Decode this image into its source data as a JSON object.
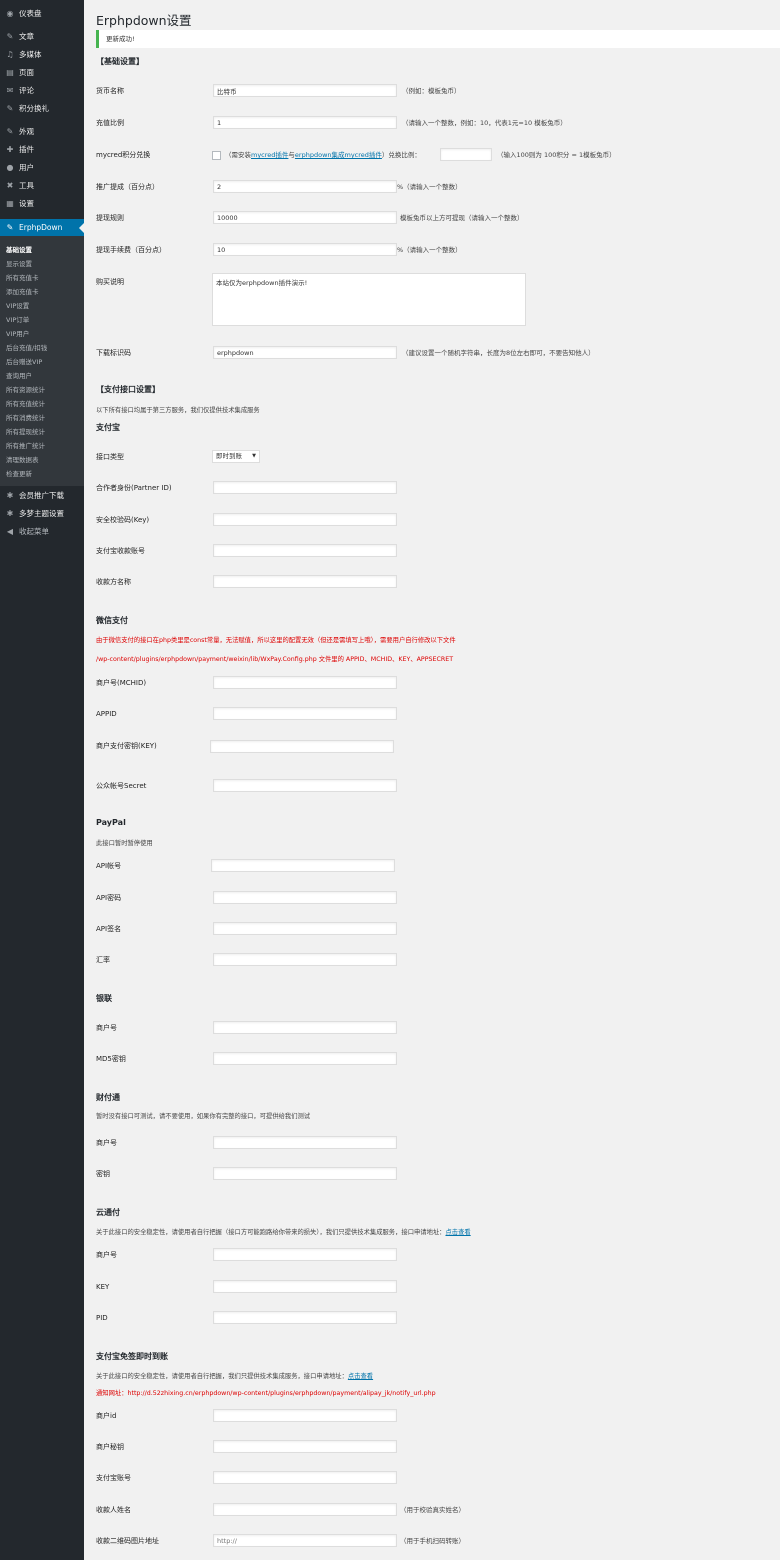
{
  "sidebar": {
    "items": [
      {
        "label": "仪表盘",
        "icon": "dashboard-icon",
        "glyph": "◉"
      },
      {
        "label": "文章",
        "icon": "pin-icon",
        "glyph": "✎"
      },
      {
        "label": "多媒体",
        "icon": "media-icon",
        "glyph": "♫"
      },
      {
        "label": "页面",
        "icon": "page-icon",
        "glyph": "▤"
      },
      {
        "label": "评论",
        "icon": "comment-icon",
        "glyph": "✉"
      },
      {
        "label": "积分换礼",
        "icon": "pin-icon",
        "glyph": "✎"
      },
      {
        "label": "外观",
        "icon": "brush-icon",
        "glyph": "✎"
      },
      {
        "label": "插件",
        "icon": "plugin-icon",
        "glyph": "✚"
      },
      {
        "label": "用户",
        "icon": "user-icon",
        "glyph": "●"
      },
      {
        "label": "工具",
        "icon": "wrench-icon",
        "glyph": "✖"
      },
      {
        "label": "设置",
        "icon": "settings-icon",
        "glyph": "▦"
      },
      {
        "label": "ErphpDown",
        "icon": "pin-icon",
        "glyph": "✎"
      },
      {
        "label": "会员推广下载",
        "icon": "gear-icon",
        "glyph": "✱"
      },
      {
        "label": "多梦主题设置",
        "icon": "gear-icon",
        "glyph": "✱"
      },
      {
        "label": "收起菜单",
        "icon": "collapse-icon",
        "glyph": "◀"
      }
    ],
    "submenu": [
      "基础设置",
      "显示设置",
      "所有充值卡",
      "添加充值卡",
      "VIP设置",
      "VIP订单",
      "VIP用户",
      "后台充值/扣钱",
      "后台赠送VIP",
      "查询用户",
      "所有资源统计",
      "所有充值统计",
      "所有消费统计",
      "所有提现统计",
      "所有推广统计",
      "清理数据表",
      "检查更新"
    ]
  },
  "page": {
    "title": "Erphpdown设置",
    "notice": "更新成功!"
  },
  "basic": {
    "title": "【基础设置】",
    "coin_name_label": "货币名称",
    "coin_name_value": "比特币",
    "coin_name_desc": "（例如：模板兔币）",
    "rate_label": "充值比例",
    "rate_value": "1",
    "rate_desc": "（请输入一个整数，例如：10，代表1元=10 模板兔币）",
    "mycred_label": "mycred积分兑换",
    "mycred_desc_pre": "（需安装",
    "mycred_link1": "mycred插件",
    "mycred_desc_mid": "与",
    "mycred_link2": "erphpdown集成mycred插件",
    "mycred_desc_post": "）兑换比例：",
    "mycred_desc2": "（输入100则为 100积分 = 1模板兔币）",
    "promo_label": "推广提成（百分点）",
    "promo_value": "2",
    "promo_desc": "%（请输入一个整数）",
    "withdraw_rule_label": "提现规则",
    "withdraw_rule_value": "10000",
    "withdraw_rule_desc": "模板兔币以上方可提现（请输入一个整数）",
    "withdraw_fee_label": "提现手续费（百分点）",
    "withdraw_fee_value": "10",
    "withdraw_fee_desc": "%（请输入一个整数）",
    "buy_desc_label": "购买说明",
    "buy_desc_value": "本站仅为erphpdown插件演示!",
    "download_id_label": "下载标识码",
    "download_id_value": "erphpdown",
    "download_id_desc": "（建议设置一个随机字符串，长度为8位左右即可，不要告知他人）"
  },
  "payment": {
    "title": "【支付接口设置】",
    "note": "以下所有接口均属于第三方服务，我们仅提供技术集成服务"
  },
  "alipay": {
    "title": "支付宝",
    "type_label": "接口类型",
    "type_value": "即时到账",
    "partner_label": "合作者身份(Partner ID)",
    "key_label": "安全校验码(Key)",
    "account_label": "支付宝收款账号",
    "name_label": "收款方名称"
  },
  "wechat": {
    "title": "微信支付",
    "note1": "由于微信支付的接口在php类里是const常量，无法赋值，所以这里的配置无效（但还是需填写上哦），需要用户自行修改以下文件",
    "note2": "/wp-content/plugins/erphpdown/payment/weixin/lib/WxPay.Config.php 文件里的 APPID、MCHID、KEY、APPSECRET",
    "mchid_label": "商户号(MCHID)",
    "appid_label": "APPID",
    "key_label": "商户支付密钥(KEY)",
    "secret_label": "公众帐号Secret"
  },
  "paypal": {
    "title": "PayPal",
    "note": "此接口暂时暂停使用",
    "account_label": "API帐号",
    "password_label": "API密码",
    "signature_label": "API签名",
    "rate_label": "汇率"
  },
  "unionpay": {
    "title": "银联",
    "merchant_label": "商户号",
    "md5_label": "MD5密钥"
  },
  "tenpay": {
    "title": "财付通",
    "note": "暂时没有接口可测试，请不要使用，如果你有完整的接口，可提供给我们测试",
    "merchant_label": "商户号",
    "key_label": "密钥"
  },
  "yuntong": {
    "title": "云通付",
    "note": "关于此接口的安全稳定性，请使用者自行把握（接口方可能跑路给你带来的损失），我们只提供技术集成服务，接口申请地址：",
    "note_link": "点击查看",
    "merchant_label": "商户号",
    "key_label": "KEY",
    "pid_label": "PID"
  },
  "alipay_free": {
    "title": "支付宝免签即时到账",
    "note": "关于此接口的安全稳定性，请使用者自行把握，我们只提供技术集成服务，接口申请地址：",
    "note_link": "点击查看",
    "notify": "通知网址：http://d.52zhixing.cn/erphpdown/wp-content/plugins/erphpdown/payment/alipay_jk/notify_url.php",
    "merchant_label": "商户id",
    "key_label": "商户秘钥",
    "account_label": "支付宝账号",
    "payee_label": "收款人姓名",
    "payee_desc": "（用于校验真实姓名）",
    "qr_label": "收款二维码图片地址",
    "qr_placeholder": "http://",
    "qr_desc": "（用于手机扫码转账）"
  }
}
